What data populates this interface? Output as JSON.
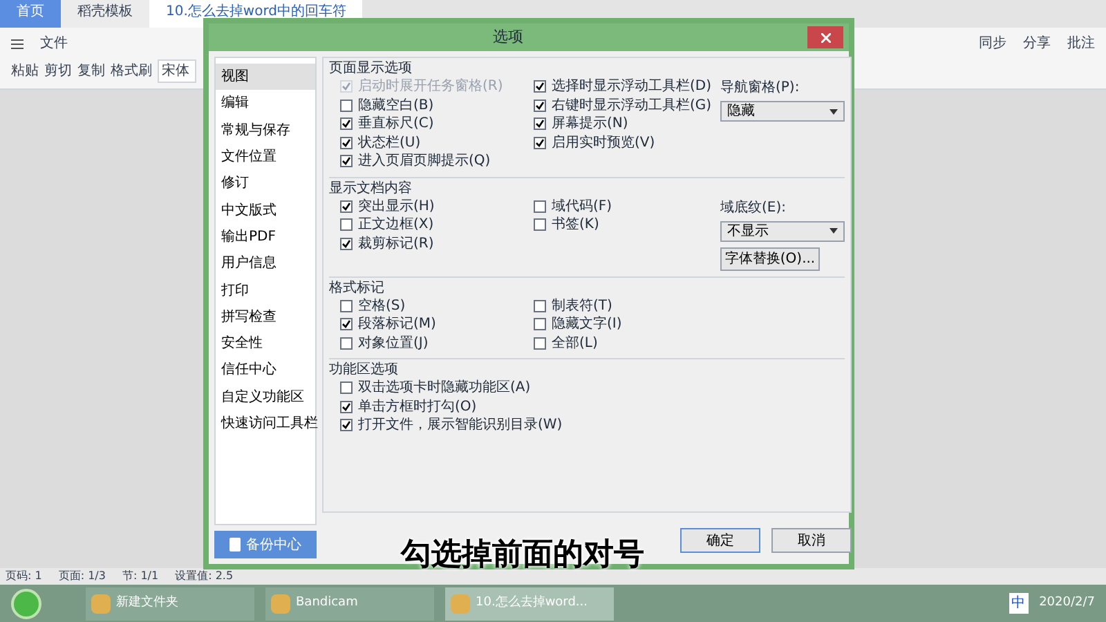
{
  "app_tabs": [
    {
      "label": "首页",
      "selected": false
    },
    {
      "label": "稻壳模板",
      "selected": false
    },
    {
      "label": "10.怎么去掉word中的回车符",
      "selected": true
    }
  ],
  "menu": {
    "file": "文件",
    "font": "宋体",
    "paste": "粘贴",
    "cut": "剪切",
    "copy": "复制",
    "format_painter": "格式刷"
  },
  "right_tools": [
    "同步",
    "分享",
    "批注"
  ],
  "dialog": {
    "title": "选项",
    "sidebar": [
      {
        "label": "视图",
        "selected": true
      },
      {
        "label": "编辑",
        "selected": false
      },
      {
        "label": "常规与保存",
        "selected": false
      },
      {
        "label": "文件位置",
        "selected": false
      },
      {
        "label": "修订",
        "selected": false
      },
      {
        "label": "中文版式",
        "selected": false
      },
      {
        "label": "输出PDF",
        "selected": false
      },
      {
        "label": "用户信息",
        "selected": false
      },
      {
        "label": "打印",
        "selected": false
      },
      {
        "label": "拼写检查",
        "selected": false
      },
      {
        "label": "安全性",
        "selected": false
      },
      {
        "label": "信任中心",
        "selected": false
      },
      {
        "label": "自定义功能区",
        "selected": false
      },
      {
        "label": "快速访问工具栏",
        "selected": false
      }
    ],
    "backup_button": "备份中心",
    "sections": [
      {
        "title": "页面显示选项",
        "left": [
          {
            "label": "启动时展开任务窗格(R)",
            "checked": true,
            "disabled": true
          },
          {
            "label": "隐藏空白(B)",
            "checked": false,
            "disabled": false
          },
          {
            "label": "垂直标尺(C)",
            "checked": true,
            "disabled": false
          },
          {
            "label": "状态栏(U)",
            "checked": true,
            "disabled": false
          },
          {
            "label": "进入页眉页脚提示(Q)",
            "checked": true,
            "disabled": false
          }
        ],
        "right": [
          {
            "label": "选择时显示浮动工具栏(D)",
            "checked": true,
            "disabled": false
          },
          {
            "label": "右键时显示浮动工具栏(G)",
            "checked": true,
            "disabled": false
          },
          {
            "label": "屏幕提示(N)",
            "checked": true,
            "disabled": false
          },
          {
            "label": "启用实时预览(V)",
            "checked": true,
            "disabled": false
          }
        ],
        "extra": [
          {
            "kind": "select",
            "label": "导航窗格(P):",
            "value": "隐藏"
          }
        ]
      },
      {
        "title": "显示文档内容",
        "left": [
          {
            "label": "突出显示(H)",
            "checked": true,
            "disabled": false
          },
          {
            "label": "正文边框(X)",
            "checked": false,
            "disabled": false
          },
          {
            "label": "裁剪标记(R)",
            "checked": true,
            "disabled": false
          }
        ],
        "right": [
          {
            "label": "域代码(F)",
            "checked": false,
            "disabled": false
          },
          {
            "label": "书签(K)",
            "checked": false,
            "disabled": false
          }
        ],
        "extra": [
          {
            "kind": "select",
            "label": "域底纹(E):",
            "value": "不显示"
          },
          {
            "kind": "button",
            "label": "字体替换(O)..."
          }
        ]
      },
      {
        "title": "格式标记",
        "left": [
          {
            "label": "空格(S)",
            "checked": false,
            "disabled": false
          },
          {
            "label": "段落标记(M)",
            "checked": true,
            "disabled": false
          },
          {
            "label": "对象位置(J)",
            "checked": false,
            "disabled": false
          }
        ],
        "right": [
          {
            "label": "制表符(T)",
            "checked": false,
            "disabled": false
          },
          {
            "label": "隐藏文字(I)",
            "checked": false,
            "disabled": false
          },
          {
            "label": "全部(L)",
            "checked": false,
            "disabled": false
          }
        ]
      },
      {
        "title": "功能区选项",
        "left": [
          {
            "label": "双击选项卡时隐藏功能区(A)",
            "checked": false,
            "disabled": false
          },
          {
            "label": "单击方框时打勾(O)",
            "checked": true,
            "disabled": false
          },
          {
            "label": "打开文件，展示智能识别目录(W)",
            "checked": true,
            "disabled": false
          }
        ]
      }
    ],
    "buttons": [
      "确定",
      "取消"
    ]
  },
  "caption": "勾选掉前面的对号",
  "status_bar": [
    "页码: 1",
    "页面: 1/3",
    "节: 1/1",
    "设置值: 2.5"
  ],
  "taskbar": {
    "items": [
      {
        "label": "新建文件夹",
        "selected": false
      },
      {
        "label": "Bandicam",
        "selected": false
      },
      {
        "label": "10.怎么去掉word...",
        "selected": true
      }
    ],
    "ime": "中",
    "date": "2020/2/7"
  }
}
